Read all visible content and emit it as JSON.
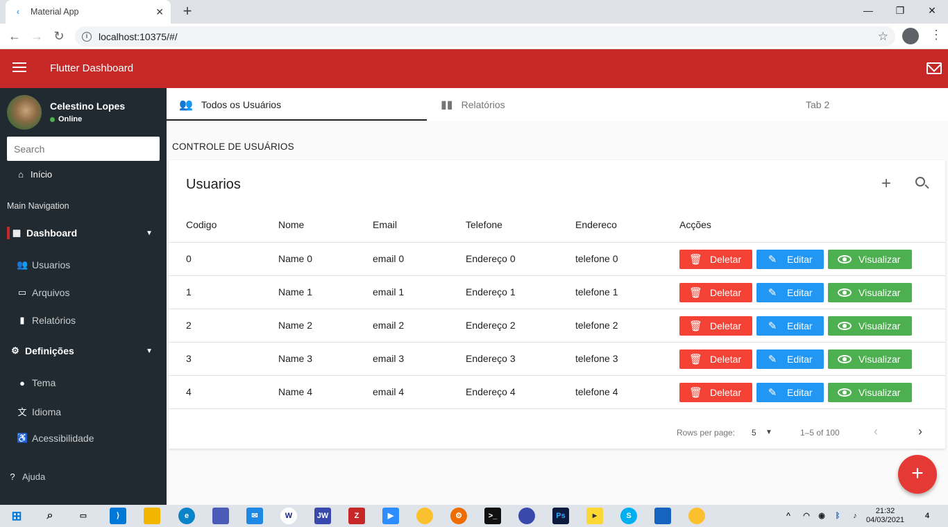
{
  "browser": {
    "tab_title": "Material App",
    "address": "localhost:10375/#/"
  },
  "appbar": {
    "title": "Flutter Dashboard"
  },
  "sidebar": {
    "user_name": "Celestino Lopes",
    "status": "Online",
    "search_placeholder": "Search",
    "home": "Início",
    "section": "Main Navigation",
    "dashboard": "Dashboard",
    "items": [
      {
        "label": "Usuarios",
        "icon": "people-icon"
      },
      {
        "label": "Arquivos",
        "icon": "card-icon"
      },
      {
        "label": "Relatórios",
        "icon": "bar-chart-icon"
      }
    ],
    "settings": "Definições",
    "settings_items": [
      {
        "label": "Tema",
        "icon": "palette-icon"
      },
      {
        "label": "Idioma",
        "icon": "translate-icon"
      },
      {
        "label": "Acessibilidade",
        "icon": "accessibility-icon"
      }
    ],
    "help": "Ajuda"
  },
  "tabs": [
    {
      "label": "Todos os Usuários"
    },
    {
      "label": "Relatórios"
    },
    {
      "label": "Tab 2"
    }
  ],
  "section_title": "CONTROLE DE USUÁRIOS",
  "card": {
    "title": "Usuarios",
    "columns": [
      "Codigo",
      "Nome",
      "Email",
      "Telefone",
      "Endereco",
      "Acções"
    ],
    "rows": [
      [
        "0",
        "Name 0",
        "email 0",
        "Endereço 0",
        "telefone 0"
      ],
      [
        "1",
        "Name 1",
        "email 1",
        "Endereço 1",
        "telefone 1"
      ],
      [
        "2",
        "Name 2",
        "email 2",
        "Endereço 2",
        "telefone 2"
      ],
      [
        "3",
        "Name 3",
        "email 3",
        "Endereço 3",
        "telefone 3"
      ],
      [
        "4",
        "Name 4",
        "email 4",
        "Endereço 4",
        "telefone 4"
      ]
    ],
    "actions": {
      "delete": "Deletar",
      "edit": "Editar",
      "view": "Visualizar"
    },
    "footer": {
      "rows_per_page_label": "Rows per page:",
      "rows_per_page": "5",
      "range": "1–5 of 100"
    }
  },
  "taskbar": {
    "time": "21:32",
    "date": "04/03/2021",
    "notif_count": "4"
  },
  "colors": {
    "appbar": "#c62828",
    "sidebar": "#212a30",
    "delete": "#f44336",
    "edit": "#2196f3",
    "view": "#4caf50"
  }
}
